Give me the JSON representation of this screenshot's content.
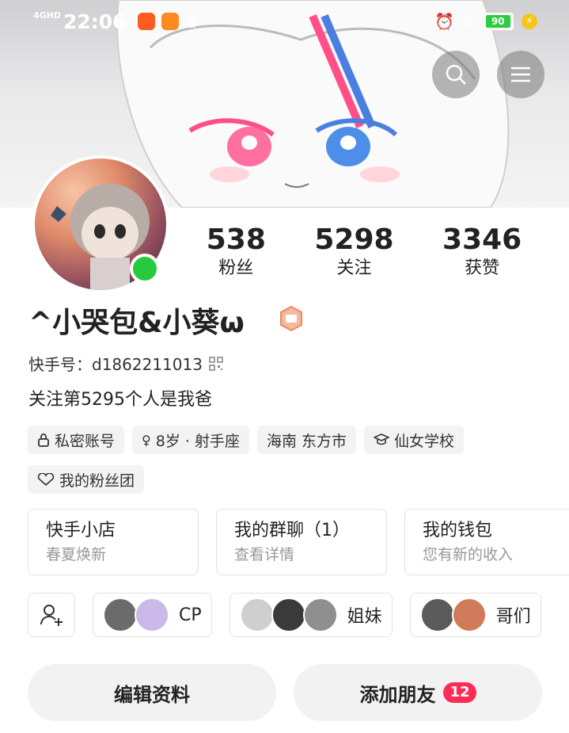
{
  "status": {
    "network": "4GHD",
    "time": "22:06",
    "battery": "90"
  },
  "profile": {
    "nickname": "^小哭包&小葵ω",
    "kuaishou_id": "快手号：d1862211013",
    "bio": "关注第5295个人是我爸",
    "stats": [
      {
        "value": "538",
        "label": "粉丝"
      },
      {
        "value": "5298",
        "label": "关注"
      },
      {
        "value": "3346",
        "label": "获赞"
      }
    ],
    "tags": [
      {
        "label": "私密账号",
        "icon": "lock-icon"
      },
      {
        "label": "8岁 · 射手座",
        "icon": "female-icon"
      },
      {
        "label": "海南 东方市",
        "icon": ""
      },
      {
        "label": "仙女学校",
        "icon": "graduation-cap-icon"
      },
      {
        "label": "我的粉丝团",
        "icon": "heart-handshake-icon"
      }
    ]
  },
  "cards": [
    {
      "title": "快手小店",
      "subtitle": "春夏焕新"
    },
    {
      "title": "我的群聊（1）",
      "subtitle": "查看详情"
    },
    {
      "title": "我的钱包",
      "subtitle": "您有新的收入"
    }
  ],
  "groups": [
    {
      "label": "CP"
    },
    {
      "label": "姐妹"
    },
    {
      "label": "哥们"
    }
  ],
  "actions": {
    "edit": "编辑资料",
    "add_friend": "添加朋友",
    "add_friend_badge": "12"
  },
  "colors": {
    "accent": "#fe2c55",
    "online": "#27c93f"
  }
}
